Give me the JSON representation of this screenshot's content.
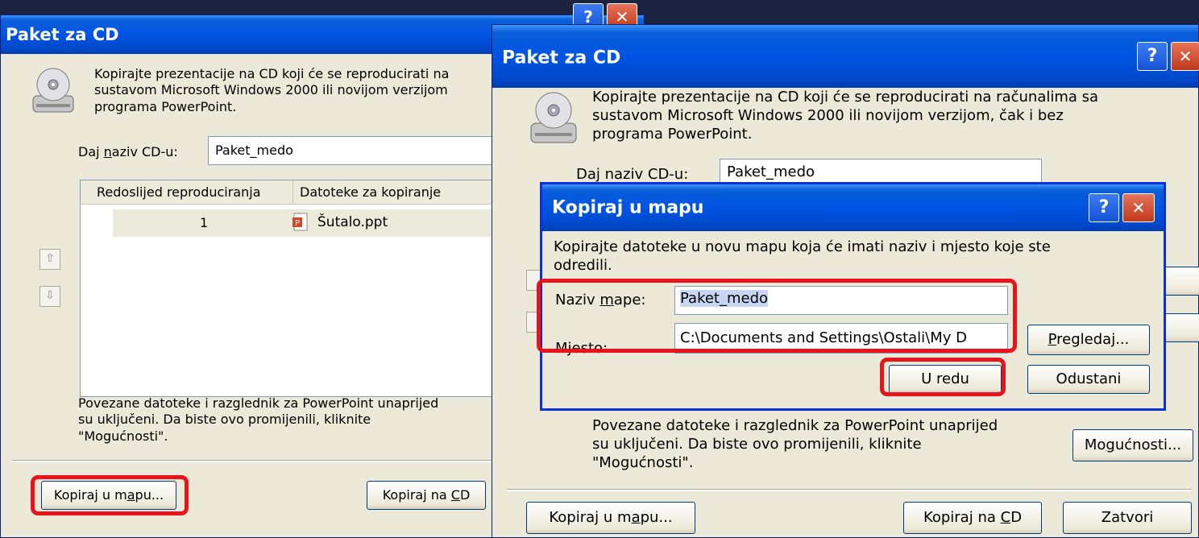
{
  "back_dialog": {
    "title": "Paket za CD",
    "description": "Kopirajte prezentacije na CD koji će se reproducirati na",
    "description2": "sustavom Microsoft Windows 2000 ili novijom verzijom",
    "description3": "programa PowerPoint.",
    "name_label_pre": "Daj ",
    "name_label_u": "n",
    "name_label_post": "aziv CD-u:",
    "name_value": "Paket_medo",
    "col_order": "Redoslijed reproduciranja",
    "col_files": "Datoteke za kopiranje",
    "rows": [
      {
        "order": "1",
        "file": "Šutalo.ppt"
      }
    ],
    "footer_text1": "Povezane datoteke i razglednik za PowerPoint unaprijed",
    "footer_text2": "su uključeni. Da biste ovo promijenili, kliknite",
    "footer_text3": "\"Mogućnosti\".",
    "copy_folder_pre": "Kopiraj u m",
    "copy_folder_u": "a",
    "copy_folder_post": "pu...",
    "copy_cd_pre": "Kopiraj na ",
    "copy_cd_u": "C",
    "copy_cd_post": "D"
  },
  "front_dialog": {
    "title": "Paket za CD",
    "description1": "Kopirajte prezentacije na CD koji će se reproducirati na računalima sa",
    "description2": "sustavom Microsoft Windows 2000 ili novijom verzijom, čak i bez",
    "description3": "programa PowerPoint.",
    "name_label": "Daj naziv CD-u:",
    "name_value": "Paket_medo",
    "footer_text1": "Povezane datoteke i razglednik za PowerPoint unaprijed",
    "footer_text2": "su uključeni. Da biste ovo promijenili, kliknite",
    "footer_text3": "\"Mogućnosti\".",
    "options_pre": "Mo",
    "options_u": "g",
    "options_post": "ućnosti...",
    "copy_folder_pre": "Kopiraj u m",
    "copy_folder_u": "a",
    "copy_folder_post": "pu...",
    "copy_cd_pre": "Kopiraj na ",
    "copy_cd_u": "C",
    "copy_cd_post": "D",
    "close_label": "Zatvori"
  },
  "copy_dialog": {
    "title": "Kopiraj u mapu",
    "description1": "Kopirajte datoteke u novu mapu koja će imati naziv i mjesto koje ste",
    "description2": "odredili.",
    "folder_label_pre": "Naziv ",
    "folder_label_u": "m",
    "folder_label_post": "ape:",
    "folder_value": "Paket_medo",
    "location_label_pre": "M",
    "location_label_u": "j",
    "location_label_post": "esto:",
    "location_value": "C:\\Documents and Settings\\Ostali\\My D",
    "browse_pre": "",
    "browse_u": "P",
    "browse_post": "regledaj...",
    "ok_label": "U redu",
    "cancel_label": "Odustani"
  },
  "title_buttons": {
    "help": "?",
    "close": "✕"
  },
  "icons": {
    "cd_drive": "cd-drive-icon",
    "ppt_file": "ppt-file-icon",
    "arrow_up": "arrow-up-icon",
    "arrow_down": "arrow-down-icon"
  },
  "colors": {
    "title_bar": "#0054e3",
    "dialog_bg": "#ece9d8",
    "highlight": "#e8131b",
    "desktop": "#1c2340"
  }
}
